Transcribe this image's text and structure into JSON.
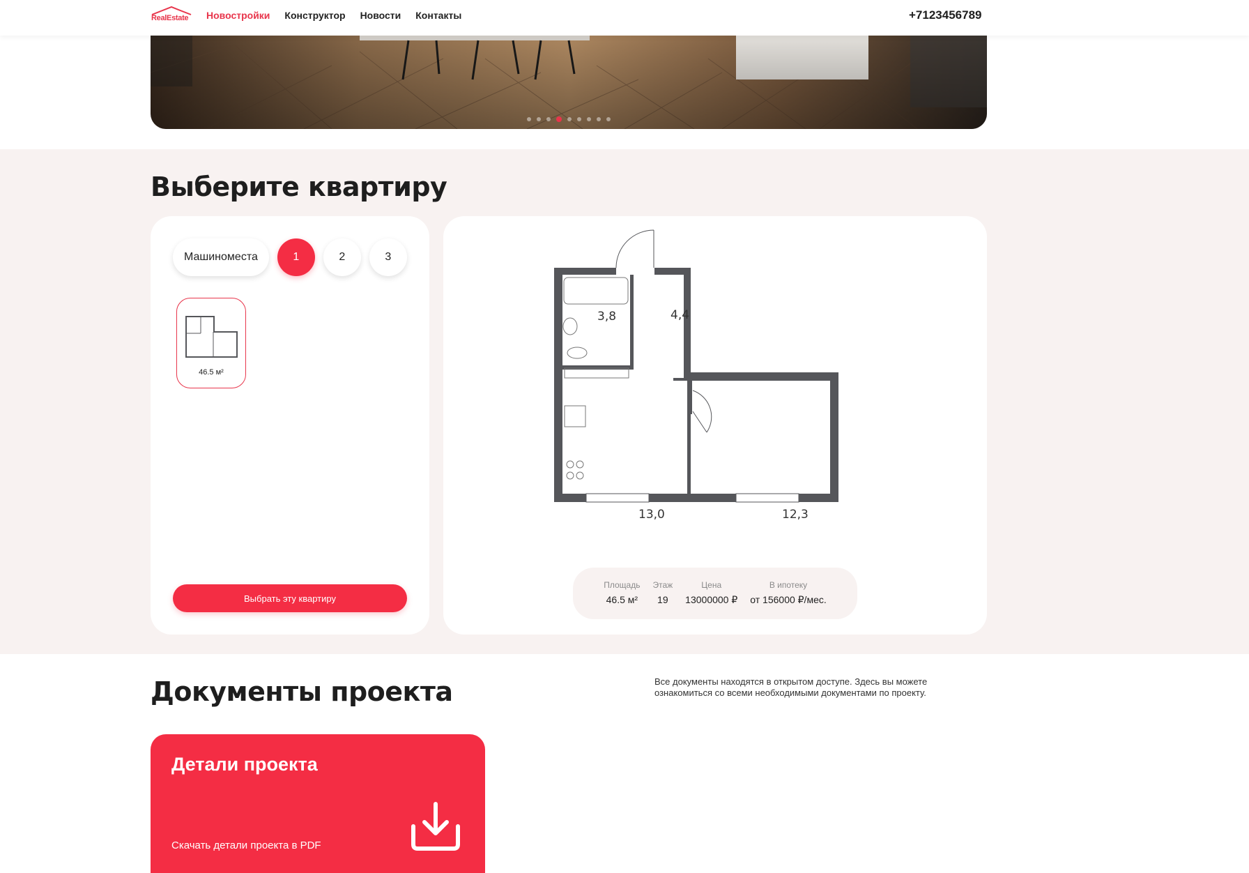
{
  "header": {
    "logo_text": "RealEstate",
    "nav": [
      {
        "label": "Новостройки",
        "active": true
      },
      {
        "label": "Конструктор",
        "active": false
      },
      {
        "label": "Новости",
        "active": false
      },
      {
        "label": "Контакты",
        "active": false
      }
    ],
    "phone": "+7123456789"
  },
  "hero": {
    "slide_count": 9,
    "active_slide": 4
  },
  "apartment": {
    "title": "Выберите квартиру",
    "filters": [
      {
        "label": "Машиноместа",
        "active": false
      },
      {
        "label": "1",
        "active": true
      },
      {
        "label": "2",
        "active": false
      },
      {
        "label": "3",
        "active": false
      }
    ],
    "plan_thumb_area": "46.5 м²",
    "select_button": "Выбрать эту квартиру",
    "rooms": {
      "bathroom": "3,8",
      "hall": "4,4",
      "kitchen": "13,0",
      "bedroom": "12,3"
    },
    "info": {
      "area_label": "Площадь",
      "area_value": "46.5 м²",
      "floor_label": "Этаж",
      "floor_value": "19",
      "price_label": "Цена",
      "price_value": "13000000 ₽",
      "mortgage_label": "В ипотеку",
      "mortgage_value": "от 156000 ₽/мес."
    }
  },
  "documents": {
    "title": "Документы проекта",
    "description": "Все документы находятся в открытом доступе. Здесь вы можете ознакомиться со всеми необходимыми документами по проекту.",
    "card_title": "Детали проекта",
    "card_subtitle": "Скачать детали проекта в PDF"
  },
  "colors": {
    "accent": "#f42d44",
    "section_bg": "#f8f2f1",
    "wall": "#55565a"
  }
}
